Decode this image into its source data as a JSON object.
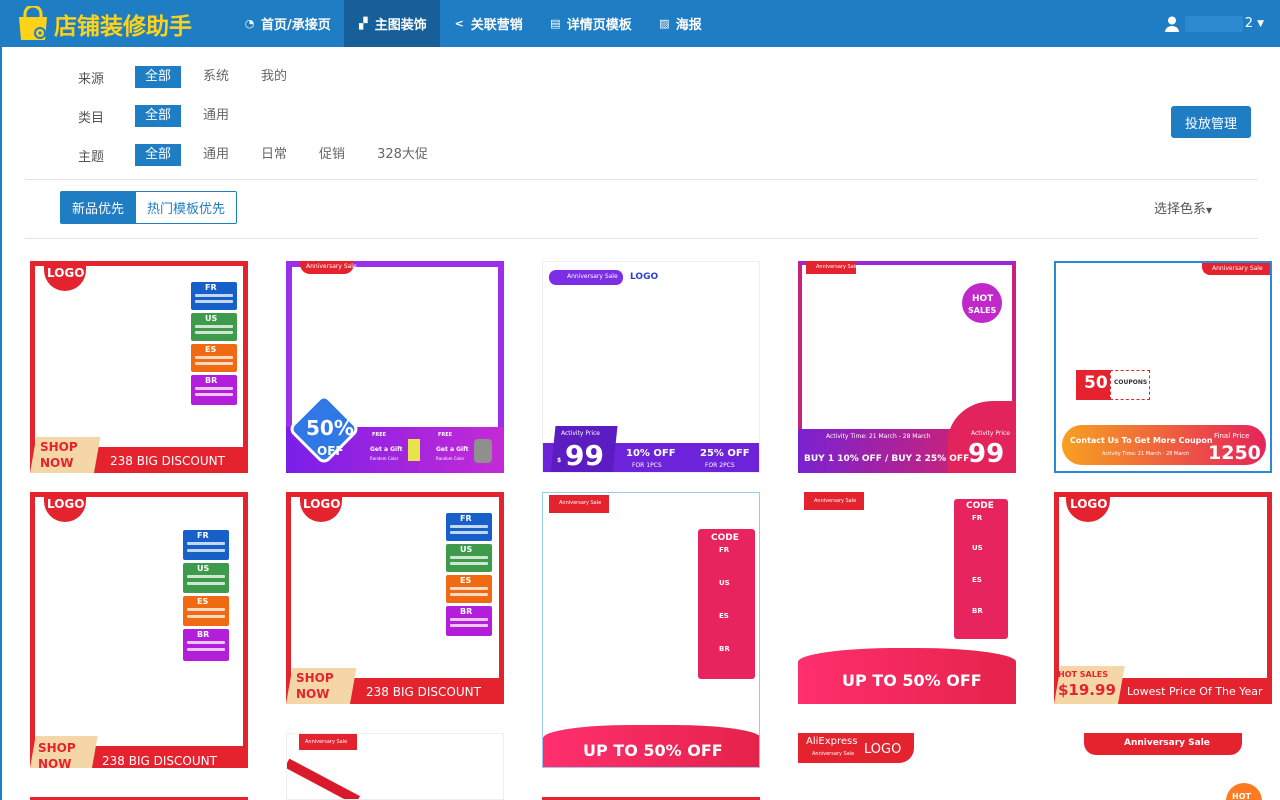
{
  "app": {
    "title": "店铺装修助手"
  },
  "nav": [
    {
      "icon": "dashboard-icon",
      "label": "首页/承接页",
      "active": false
    },
    {
      "icon": "image-icon",
      "label": "主图装饰",
      "active": true
    },
    {
      "icon": "share-icon",
      "label": "关联营销",
      "active": false
    },
    {
      "icon": "list-icon",
      "label": "详情页模板",
      "active": false
    },
    {
      "icon": "picture-icon",
      "label": "海报",
      "active": false
    }
  ],
  "user": {
    "suffix": "2"
  },
  "filters": [
    {
      "label": "来源",
      "options": [
        "全部",
        "系统",
        "我的"
      ],
      "selected": "全部"
    },
    {
      "label": "类目",
      "options": [
        "全部",
        "通用"
      ],
      "selected": "全部"
    },
    {
      "label": "主题",
      "options": [
        "全部",
        "通用",
        "日常",
        "促销",
        "328大促"
      ],
      "selected": "全部"
    }
  ],
  "manage_button": "投放管理",
  "sort": {
    "options": [
      "新品优先",
      "热门模板优先"
    ],
    "selected": "新品优先"
  },
  "color_picker": "选择色系",
  "templates": {
    "logo": "LOGO",
    "shop": "SHOP",
    "now": "NOW",
    "big_discount": "238 BIG DISCOUNT",
    "anniv": "Anniversary Sale",
    "pct50": "50%",
    "off": "OFF",
    "free": "FREE",
    "gift": "Get a Gift",
    "random_color": "Random Color",
    "activity_price": "Activity Price",
    "price99": "99",
    "off10": "10% OFF",
    "for1": "FOR 1PCS",
    "off25": "25% OFF",
    "for2": "FOR 2PCS",
    "hot": "HOT",
    "sales": "SALES",
    "activity_time": "Activity Time: 21 March - 28 March",
    "buy_line": "BUY 1 10% OFF / BUY 2 25% OFF",
    "coupon_50": "50",
    "coupons": "COUPONS",
    "contact": "Contact Us To Get More Coupon",
    "final_price": "Final Price",
    "price1250": "1250",
    "code": "CODE",
    "up_to": "UP TO 50% OFF",
    "hot_sales": "HOT SALES",
    "price1999": "$19.99",
    "lowest": "Lowest Price Of The Year",
    "aliexpress": "AliExpress",
    "dollar": "$",
    "countries": [
      "FR",
      "US",
      "ES",
      "BR"
    ]
  },
  "colors": {
    "primary": "#1f7dc3",
    "brand_yellow": "#ffd21a",
    "red": "#e4232f",
    "purple": "#8a2be2"
  }
}
